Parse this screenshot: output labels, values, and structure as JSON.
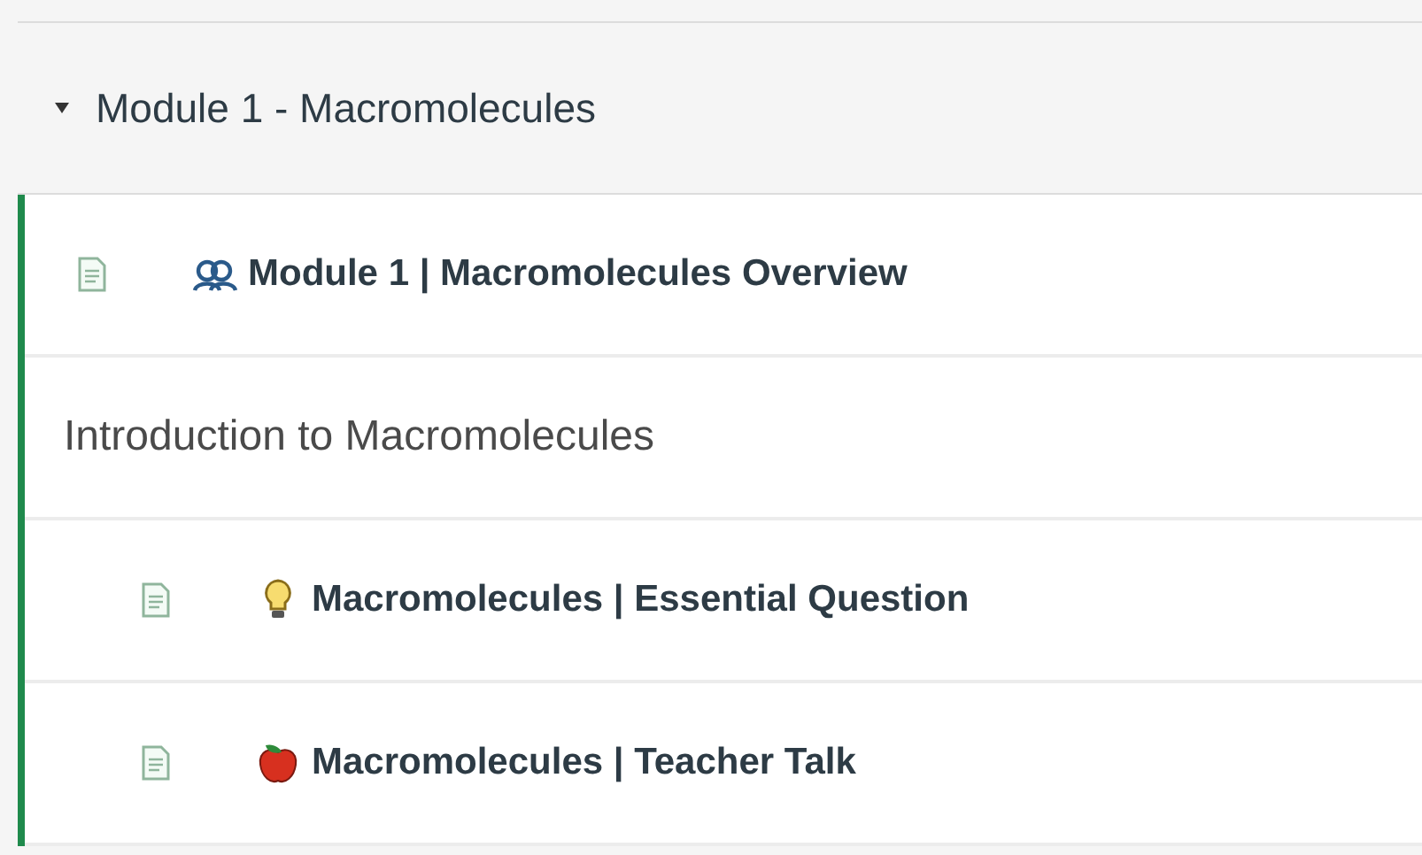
{
  "module": {
    "title": "Module 1 - Macromolecules",
    "expanded": true,
    "items": [
      {
        "kind": "people",
        "title": "Module 1 | Macromolecules Overview"
      },
      {
        "kind": "subheader",
        "title": "Introduction to Macromolecules",
        "children": [
          {
            "kind": "bulb",
            "title": "Macromolecules | Essential Question"
          },
          {
            "kind": "apple",
            "title": "Macromolecules | Teacher Talk"
          }
        ]
      }
    ]
  }
}
